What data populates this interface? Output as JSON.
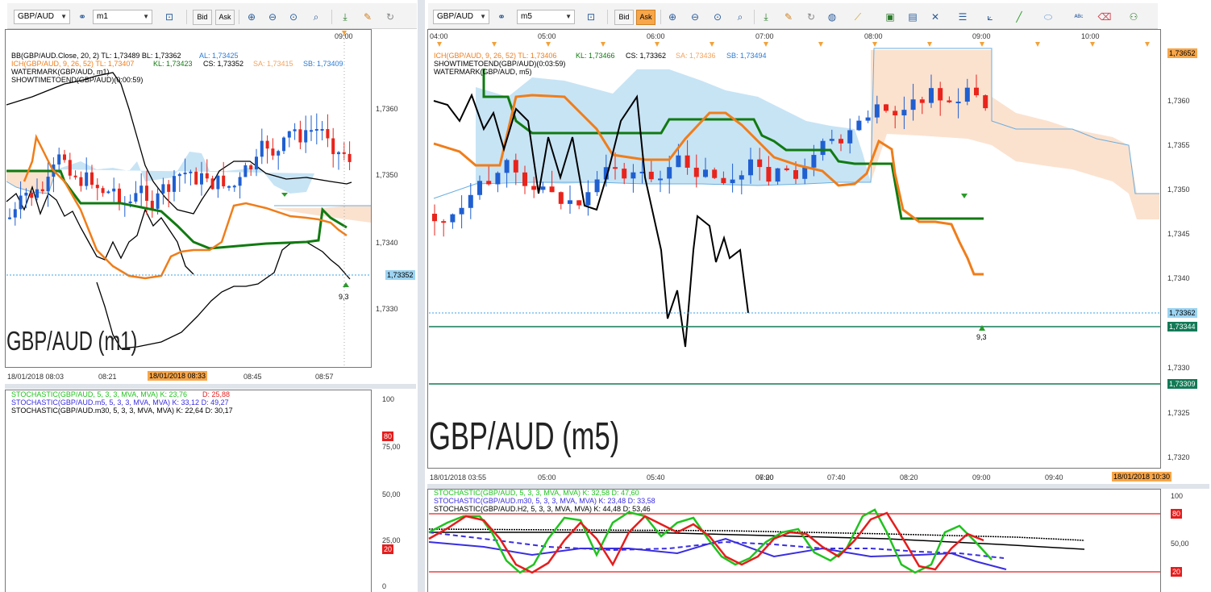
{
  "left": {
    "toolbar": {
      "symbol": "GBP/AUD",
      "timeframe": "m1",
      "bid": "Bid",
      "ask": "Ask"
    },
    "time_top": "09:00",
    "legend": [
      {
        "text": "BB(GBP/AUD.Close, 20, 2)  TL: 1,73489  BL: 1,73362",
        "color": "#000000"
      },
      {
        "text": "AL: 1,73425",
        "color": "#2a7bd6"
      },
      {
        "text": "ICH(GBP/AUD, 9, 26, 52)  TL: 1,73407",
        "color": "#f07d1a"
      },
      {
        "text": "KL: 1,73423",
        "color": "#117a11"
      },
      {
        "text": "CS: 1,73352",
        "color": "#000000"
      },
      {
        "text": "SA: 1,73415",
        "color": "#f2a35e"
      },
      {
        "text": "SB: 1,73409",
        "color": "#2a7bd6"
      },
      {
        "text": "WATERMARK(GBP/AUD, m1)",
        "color": "#000000"
      },
      {
        "text": "SHOWTIMETOEND(GBP/AUD)(0:00:59)",
        "color": "#000000"
      }
    ],
    "price_axis": [
      "1,7360",
      "1,7350",
      "1,7340",
      "1,7330"
    ],
    "current_price": "1,73352",
    "signal_value": "9,3",
    "watermark": "GBP/AUD (m1)",
    "time_axis": [
      "18/01/2018 08:03",
      "08:21",
      "18/01/2018 08:33",
      "08:45",
      "08:57"
    ],
    "stoch_legend": [
      {
        "text": "STOCHASTIC(GBP/AUD, 5, 3, 3, MVA, MVA)  K: 23,76",
        "color": "#21c21f"
      },
      {
        "text": "D: 25,88",
        "color": "#e51d1d"
      },
      {
        "text": "STOCHASTIC(GBP/AUD.m5, 5, 3, 3, MVA, MVA)  K: 33,12  D: 49,27",
        "color": "#3a2ee0"
      },
      {
        "text": "STOCHASTIC(GBP/AUD.m30, 5, 3, 3, MVA, MVA)  K: 22,64  D: 30,17",
        "color": "#000000"
      }
    ],
    "stoch_axis": [
      "100",
      "80",
      "75,00",
      "50,00",
      "25,00",
      "20",
      "0"
    ]
  },
  "right": {
    "toolbar": {
      "symbol": "GBP/AUD",
      "timeframe": "m5",
      "bid": "Bid",
      "ask": "Ask"
    },
    "time_top": [
      "04:00",
      "05:00",
      "06:00",
      "07:00",
      "08:00",
      "09:00",
      "10:00"
    ],
    "legend": [
      {
        "text": "ICH(GBP/AUD, 9, 26, 52)  TL: 1,73406",
        "color": "#f07d1a"
      },
      {
        "text": "KL: 1,73466",
        "color": "#117a11"
      },
      {
        "text": "CS: 1,73362",
        "color": "#000000"
      },
      {
        "text": "SA: 1,73436",
        "color": "#f2a35e"
      },
      {
        "text": "SB: 1,73494",
        "color": "#2a7bd6"
      },
      {
        "text": "SHOWTIMETOEND(GBP/AUD)(0:03:59)",
        "color": "#000000"
      },
      {
        "text": "WATERMARK(GBP/AUD, m5)",
        "color": "#000000"
      }
    ],
    "price_axis": [
      "1,7365",
      "1,7360",
      "1,7355",
      "1,7350",
      "1,7345",
      "1,7340",
      "1,7335",
      "1,7330",
      "1,7325",
      "1,7320"
    ],
    "top_price": "1,73652",
    "current_price": "1,73362",
    "line1_price": "1,73344",
    "line2_price": "1,73309",
    "signal_value": "9,3",
    "watermark": "GBP/AUD (m5)",
    "time_axis": [
      "18/01/2018 03:55",
      "05:00",
      "05:40",
      "06:20",
      "07:00",
      "07:40",
      "08:20",
      "09:00",
      "09:40",
      "18/01/2018 10:30"
    ],
    "stoch_legend": [
      {
        "text": "STOCHASTIC(GBP/AUD, 5, 3, 3, MVA, MVA)  K: 32,58  D: 47,60",
        "color": "#21c21f"
      },
      {
        "text": "STOCHASTIC(GBP/AUD.m30, 5, 3, 3, MVA, MVA)  K: 23,48  D: 33,58",
        "color": "#3a2ee0"
      },
      {
        "text": "STOCHASTIC(GBP/AUD.H2, 5, 3, 3, MVA, MVA)  K: 44,48  D: 53,46",
        "color": "#000000"
      }
    ],
    "stoch_axis": [
      "100",
      "80",
      "50,00",
      "20"
    ]
  },
  "colors": {
    "up": "#1f5fd1",
    "down": "#e8241c",
    "kijun": "#117a11",
    "tenkan": "#f07d1a",
    "cloud_bull": "#c7e4f5",
    "cloud_bear": "#fbe2cf",
    "stoch_k": "#21c21f",
    "stoch_d": "#e51d1d",
    "stoch_m30": "#3a2ee0"
  }
}
